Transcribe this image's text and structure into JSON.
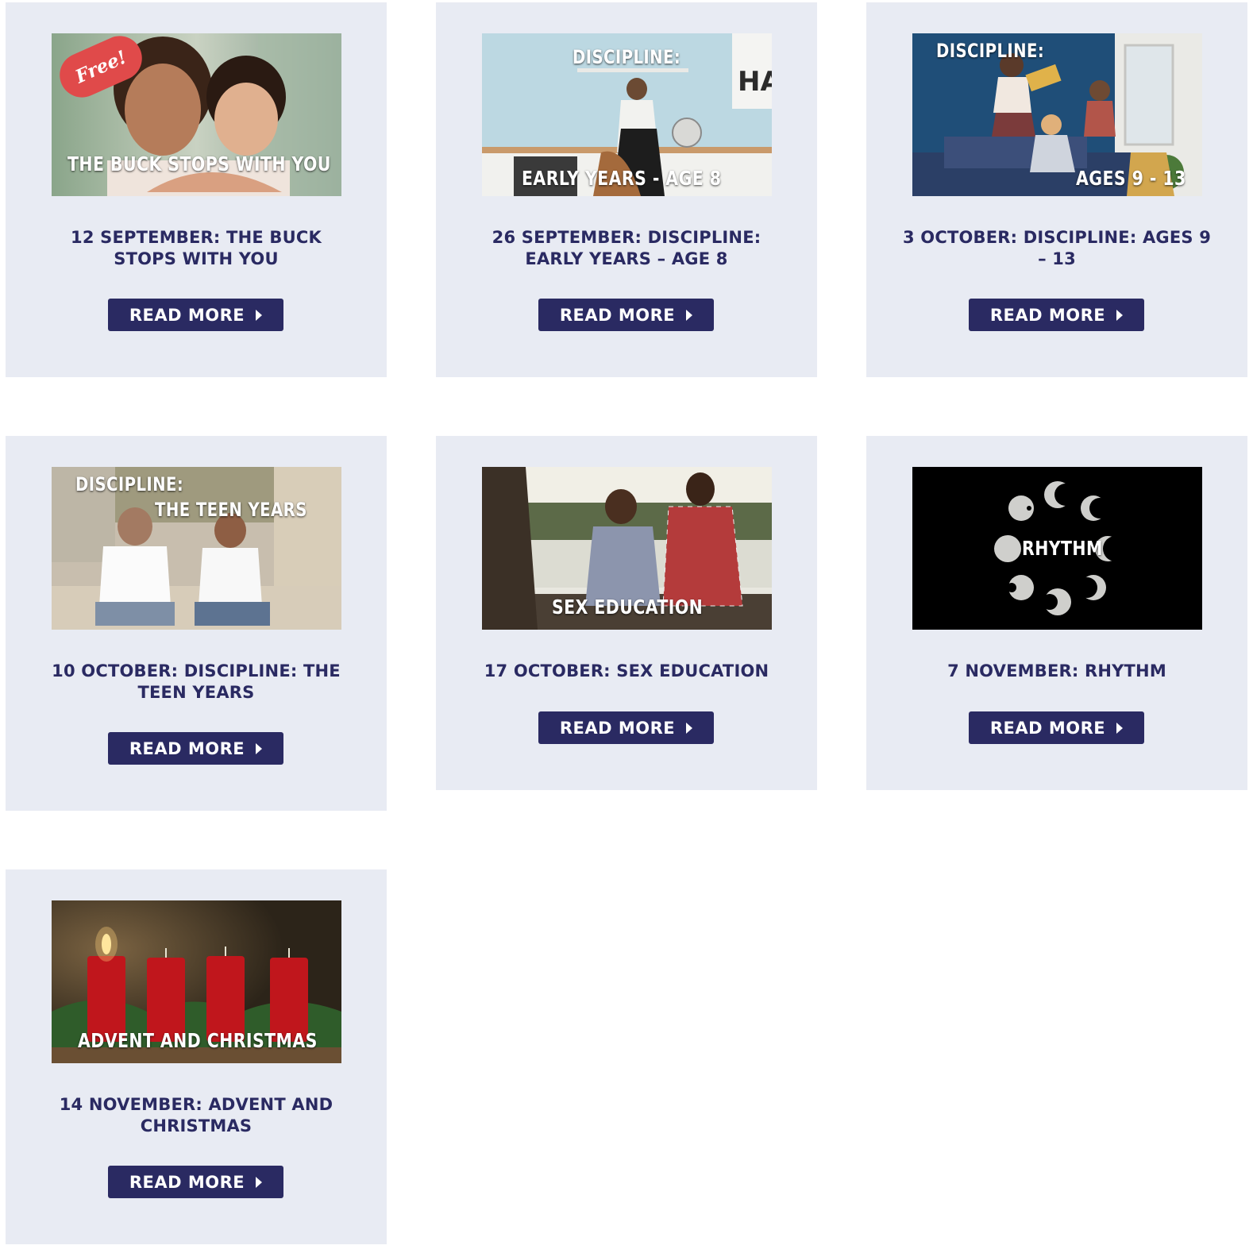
{
  "colors": {
    "card_background": "#e8ebf3",
    "title_text": "#2a2a62",
    "button_background": "#2a2a62",
    "button_text": "#ffffff"
  },
  "cards": [
    {
      "title": "12 SEPTEMBER: THE BUCK STOPS WITH YOU",
      "button_label": "READ MORE",
      "image_caption": "THE BUCK STOPS WITH YOU",
      "image_badge": "Free!"
    },
    {
      "title": "26 SEPTEMBER: DISCIPLINE: EARLY YEARS – AGE 8",
      "button_label": "READ MORE",
      "image_caption_top": "DISCIPLINE:",
      "image_caption_bottom": "EARLY YEARS - AGE 8",
      "image_sign": "HAP"
    },
    {
      "title": "3 OCTOBER: DISCIPLINE: AGES 9 – 13",
      "button_label": "READ MORE",
      "image_caption_top": "DISCIPLINE:",
      "image_caption_bottom": "AGES 9 - 13"
    },
    {
      "title": "10 OCTOBER: DISCIPLINE: THE TEEN YEARS",
      "button_label": "READ MORE",
      "image_caption_top": "DISCIPLINE:",
      "image_caption_bottom": "THE TEEN YEARS"
    },
    {
      "title": "17 OCTOBER: SEX EDUCATION",
      "button_label": "READ MORE",
      "image_caption": "SEX EDUCATION"
    },
    {
      "title": "7 NOVEMBER: RHYTHM",
      "button_label": "READ MORE",
      "image_caption": "RHYTHM"
    },
    {
      "title": "14 NOVEMBER: ADVENT AND CHRISTMAS",
      "button_label": "READ MORE",
      "image_caption": "ADVENT AND CHRISTMAS"
    }
  ]
}
